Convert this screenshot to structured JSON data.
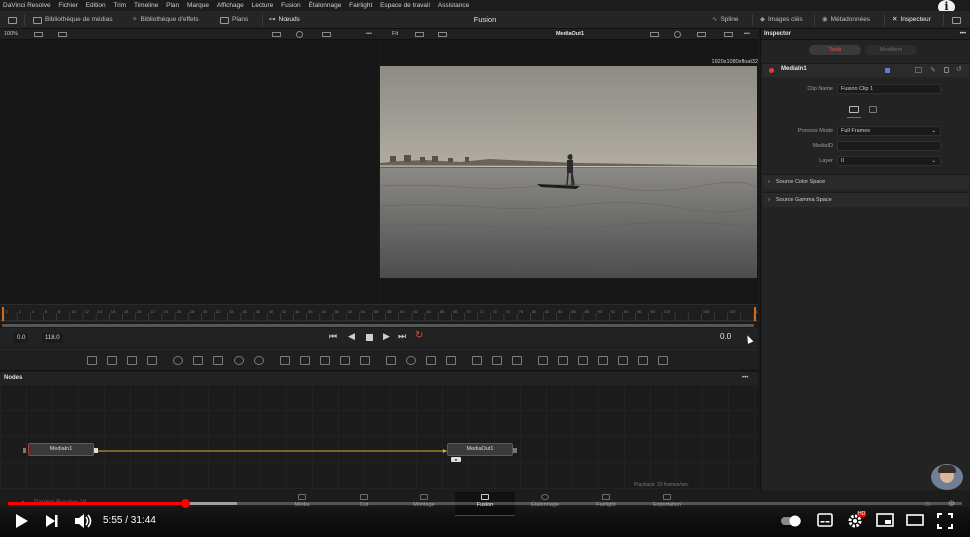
{
  "menubar": {
    "items": [
      "DaVinci Resolve",
      "Fichier",
      "Edition",
      "Trim",
      "Timeline",
      "Plan",
      "Marque",
      "Affichage",
      "Lecture",
      "Fusion",
      "Étalonnage",
      "Fairlight",
      "Espace de travail",
      "Assistance"
    ]
  },
  "toolbar": {
    "media_pool": "Bibliothèque de médias",
    "effects": "Bibliothèque d'effets",
    "clips": "Plans",
    "nodes": "Nœuds",
    "page_title": "Fusion",
    "spline": "Spline",
    "keyframes": "Images clés",
    "metadata": "Métadonnées",
    "inspector": "Inspecteur"
  },
  "viewer": {
    "zoom_left": "100%",
    "fit_right": "Fit",
    "viewer_title": "MediaOut1",
    "resolution": "1920x1080xfloat32"
  },
  "ruler": {
    "ticks": [
      "0",
      "2",
      "4",
      "6",
      "8",
      "10",
      "12",
      "14",
      "16",
      "18",
      "20",
      "22",
      "24",
      "26",
      "28",
      "30",
      "32",
      "34",
      "36",
      "38",
      "40",
      "42",
      "44",
      "46",
      "48",
      "50",
      "52",
      "54",
      "56",
      "58",
      "60",
      "62",
      "64",
      "66",
      "68",
      "70",
      "72",
      "74",
      "76",
      "78",
      "80",
      "82",
      "84",
      "86",
      "88",
      "90",
      "92",
      "94",
      "96",
      "98",
      "100",
      "",
      "",
      "108",
      "",
      "110",
      "",
      "118"
    ]
  },
  "transport": {
    "start": "0.0",
    "end": "118.0",
    "current": "0.0"
  },
  "nodes_panel": {
    "title": "Nodes",
    "node_in": "MediaIn1",
    "node_out": "MediaOut1",
    "playback": "Playback: 23 frames/sec"
  },
  "inspector": {
    "title": "Inspector",
    "tab_tools": "Tools",
    "tab_modifiers": "Modifiers",
    "node_name": "MediaIn1",
    "clip_name_label": "Clip Name",
    "clip_name_value": "Fusion Clip 1",
    "process_mode_label": "Process Mode",
    "process_mode_value": "Full Frames",
    "mediaid_label": "MediaID",
    "layer_label": "Layer",
    "layer_value": "0",
    "section_color": "Source Color Space",
    "section_gamma": "Source Gamma Space"
  },
  "pages": {
    "watermark": "DaVinci Resolve 18",
    "items": [
      "Média",
      "Cut",
      "Montage",
      "Fusion",
      "Étalonnage",
      "Fairlight",
      "Exportation"
    ],
    "active": "Fusion"
  },
  "youtube": {
    "time": "5:55 / 31:44",
    "progress_fraction": 0.1865,
    "buffered_fraction": 0.24,
    "hd_badge": "HD",
    "accent": "#ff0000"
  }
}
